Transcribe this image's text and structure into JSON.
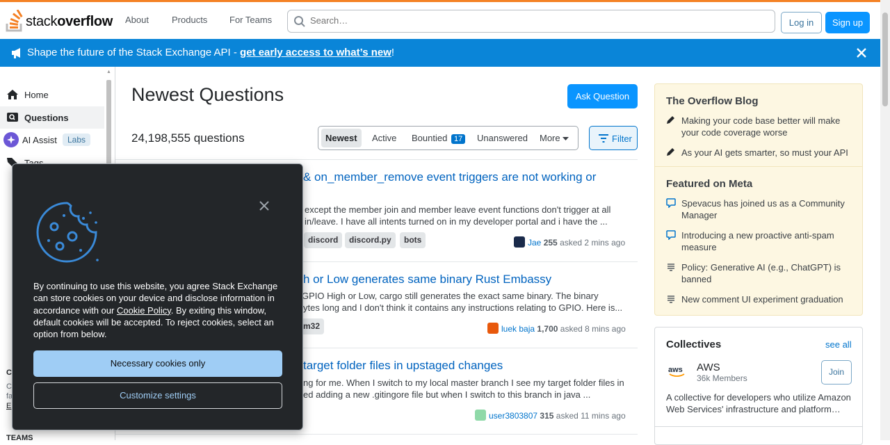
{
  "header": {
    "logo_text_light": "stack",
    "logo_text_bold": "overflow",
    "nav": [
      "About",
      "Products",
      "For Teams"
    ],
    "search_placeholder": "Search…",
    "login_label": "Log in",
    "signup_label": "Sign up",
    "accent_color": "#f48225"
  },
  "banner": {
    "text": "Shape the future of the Stack Exchange API - ",
    "link_text": "get early access to what’s new",
    "suffix": "!",
    "bg_color": "#0a85d8"
  },
  "sidebar": {
    "items": [
      {
        "label": "Home",
        "icon": "home-icon"
      },
      {
        "label": "Questions",
        "icon": "questions-icon",
        "active": true
      },
      {
        "label": "AI Assist",
        "icon": "ai-assist-icon",
        "badge": "Labs"
      },
      {
        "label": "Tags",
        "icon": "tag-icon"
      }
    ],
    "teams_label": "TEAMS",
    "peek": [
      "C",
      "C",
      "fa",
      "E"
    ]
  },
  "main": {
    "title": "Newest Questions",
    "ask_button": "Ask Question",
    "question_count": "24,198,555 questions",
    "tabs": [
      {
        "label": "Newest",
        "active": true
      },
      {
        "label": "Active"
      },
      {
        "label": "Bountied",
        "count": "17"
      },
      {
        "label": "Unanswered"
      },
      {
        "label": "More"
      }
    ],
    "filter_label": "Filter",
    "questions": [
      {
        "title": "& on_member_remove event triggers are not working or",
        "excerpt1": "except the member join and member leave event functions don't trigger at all",
        "excerpt2": "in/leave. I have all intents turned on in my developer portal and i have the ...",
        "tags": [
          "discord",
          "discord.py",
          "bots"
        ],
        "user": "Jae",
        "rep": "255",
        "asked": "asked 2 mins ago"
      },
      {
        "title": "h or Low generates same binary Rust Embassy",
        "excerpt1": "GPIO High or Low, cargo still generates the exact same binary. The binary",
        "excerpt2": "ytes long and I don't think it contains any instructions relating to GPIO. Here is...",
        "tags": [
          "m32"
        ],
        "user": "luek baja",
        "rep": "1,700",
        "asked": "asked 8 mins ago"
      },
      {
        "title": "target folder files in upstaged changes",
        "excerpt1": "ng for me. When I switch to my local master branch I see my target folder files in",
        "excerpt2": "ed adding a new .gitingore file but when I switch to this branch in java ...",
        "tags": [],
        "user": "user3803807",
        "rep": "315",
        "asked": "asked 11 mins ago"
      }
    ]
  },
  "right": {
    "blog_title": "The Overflow Blog",
    "blog_items": [
      "Making your code base better will make your code coverage worse",
      "As your AI gets smarter, so must your API"
    ],
    "meta_title": "Featured on Meta",
    "meta_items": [
      "Spevacus has joined us as a Community Manager",
      "Introducing a new proactive anti-spam measure",
      "Policy: Generative AI (e.g., ChatGPT) is banned",
      "New comment UI experiment graduation"
    ],
    "collectives_title": "Collectives",
    "see_all": "see all",
    "aws_name": "AWS",
    "aws_members": "36k Members",
    "join_label": "Join",
    "aws_desc": "A collective for developers who utilize Amazon Web Services' infrastructure and platform…"
  },
  "cookie": {
    "text_before": "By continuing to use this website, you agree Stack Exchange can store cookies on your device and disclose information in accordance with our ",
    "link": "Cookie Policy",
    "text_after": ". By exiting this window, default cookies will be accepted. To reject cookies, select an option from below.",
    "necessary_label": "Necessary cookies only",
    "customize_label": "Customize settings"
  }
}
